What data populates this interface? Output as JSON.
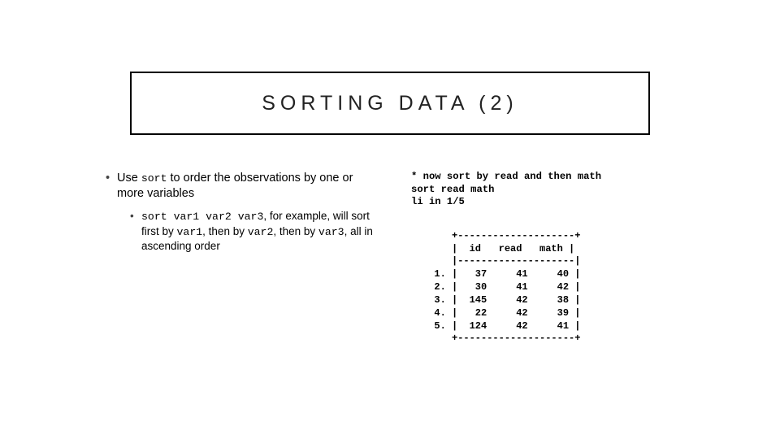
{
  "title": "SORTING DATA (2)",
  "bullet_main": {
    "pre": "Use ",
    "code": "sort",
    "post": " to order the observations by one or more variables"
  },
  "bullet_sub": {
    "p0": "",
    "c1": "sort var1 var2 var3",
    "p1": ", for example, will sort first by ",
    "c2": "var1",
    "p2": ", then by ",
    "c3": "var2",
    "p3": ", then by ",
    "c4": "var3",
    "p4": ", all in ascending order"
  },
  "code": {
    "l1": "* now sort by read and then math",
    "l2": "sort read math",
    "l3": "li in 1/5"
  },
  "output": {
    "border_top": "     +--------------------+",
    "header": "     |  id   read   math |",
    "divider": "     |--------------------|",
    "row1": "  1. |   37     41     40 |",
    "row2": "  2. |   30     41     42 |",
    "row3": "  3. |  145     42     38 |",
    "row4": "  4. |   22     42     39 |",
    "row5": "  5. |  124     42     41 |",
    "border_bot": "     +--------------------+"
  },
  "chart_data": {
    "type": "table",
    "title": "li in 1/5 after sort read math",
    "columns": [
      "id",
      "read",
      "math"
    ],
    "rows": [
      {
        "n": 1,
        "id": 37,
        "read": 41,
        "math": 40
      },
      {
        "n": 2,
        "id": 30,
        "read": 41,
        "math": 42
      },
      {
        "n": 3,
        "id": 145,
        "read": 42,
        "math": 38
      },
      {
        "n": 4,
        "id": 22,
        "read": 42,
        "math": 39
      },
      {
        "n": 5,
        "id": 124,
        "read": 42,
        "math": 41
      }
    ]
  }
}
